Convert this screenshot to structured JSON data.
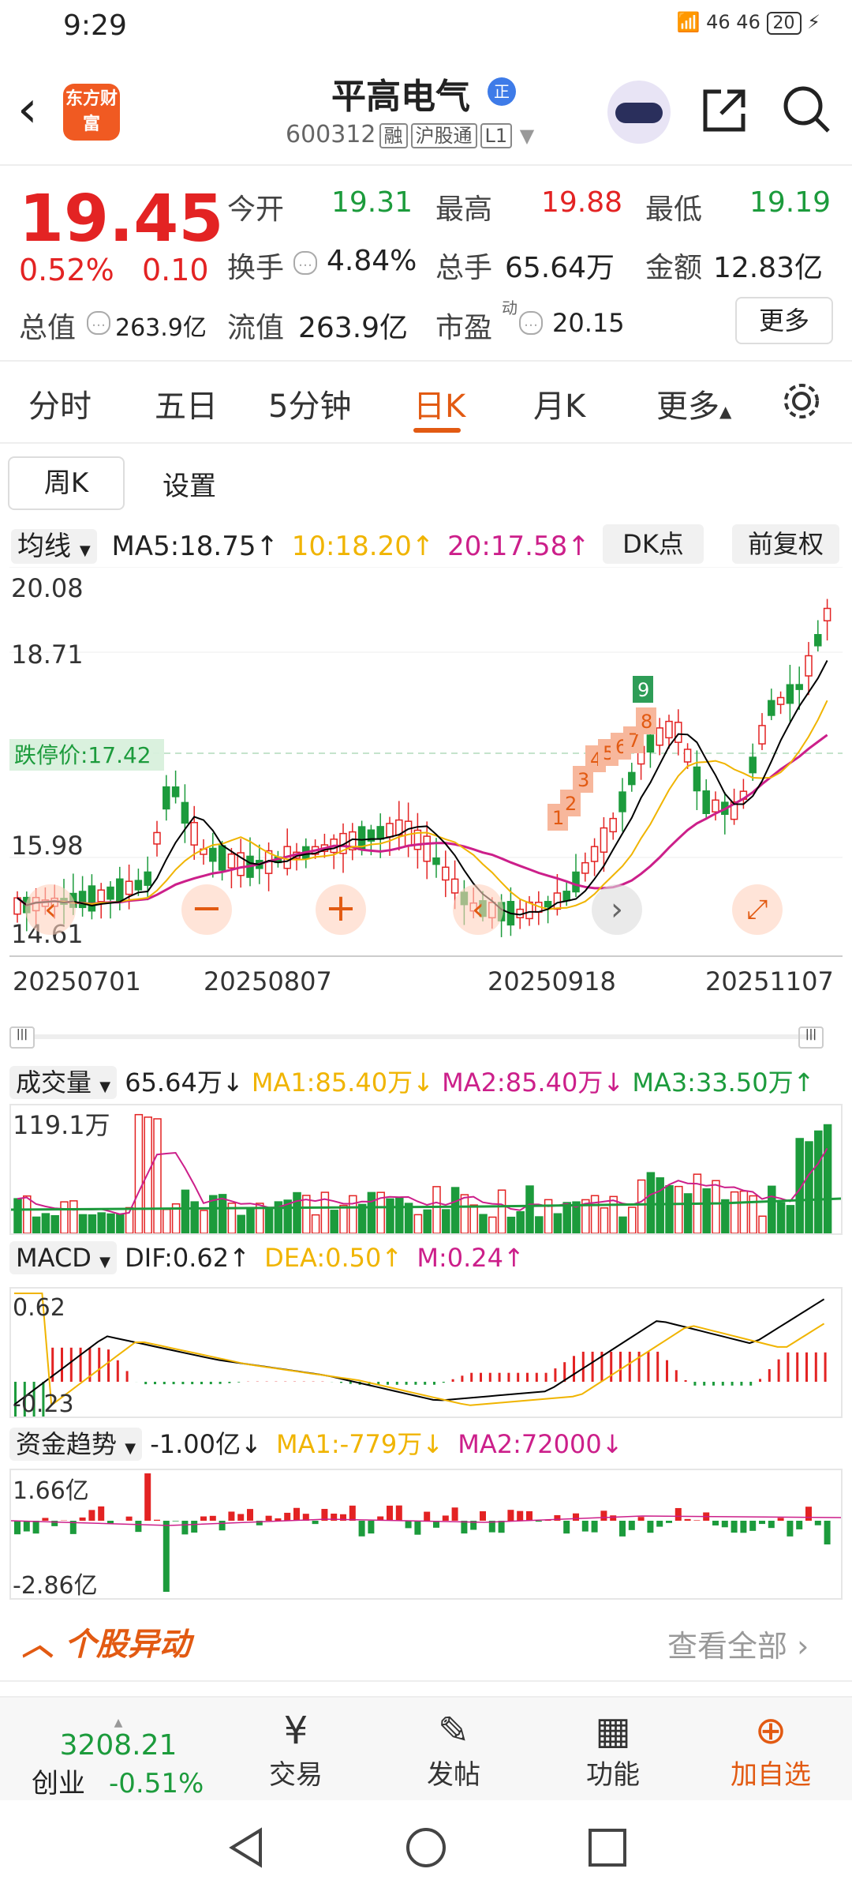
{
  "status": {
    "time": "9:29",
    "signal": "46 46",
    "battery": "20"
  },
  "header": {
    "app_logo": "东方财富",
    "stock_name": "平高电气",
    "badge": "正",
    "code": "600312",
    "tags": [
      "融",
      "沪股通",
      "L1"
    ]
  },
  "quote": {
    "price": "19.45",
    "pct": "0.52%",
    "change": "0.10",
    "open_label": "今开",
    "open": "19.31",
    "high_label": "最高",
    "high": "19.88",
    "low_label": "最低",
    "low": "19.19",
    "turnover_label": "换手",
    "turnover": "4.84%",
    "volume_label": "总手",
    "volume": "65.64万",
    "amount_label": "金额",
    "amount": "12.83亿",
    "mktcap_label": "总值",
    "mktcap": "263.9亿",
    "float_label": "流值",
    "float": "263.9亿",
    "pe_label": "市盈",
    "pe_sup": "动",
    "pe": "20.15",
    "more": "更多"
  },
  "tabs": [
    "分时",
    "五日",
    "5分钟",
    "日K",
    "月K",
    "更多"
  ],
  "sub": {
    "week": "周K",
    "settings": "设置"
  },
  "ma_legend": {
    "label": "均线",
    "ma5": "MA5:18.75↑",
    "ma10": "10:18.20↑",
    "ma20": "20:17.58↑",
    "dk": "DK点",
    "fq": "前复权"
  },
  "chart_data": {
    "type": "candlestick",
    "y_ticks": [
      "20.08",
      "18.71",
      "15.98",
      "14.61"
    ],
    "limit_down_label": "跌停价:17.42",
    "x_ticks": [
      "20250701",
      "20250807",
      "20250918",
      "20251107"
    ],
    "signals": [
      "1",
      "2",
      "3",
      "4",
      "5",
      "6",
      "7",
      "8",
      "9"
    ]
  },
  "volume": {
    "label": "成交量",
    "value": "65.64万↓",
    "ma1": "MA1:85.40万↓",
    "ma2": "MA2:85.40万↓",
    "ma3": "MA3:33.50万↑",
    "ymax": "119.1万"
  },
  "macd": {
    "label": "MACD",
    "dif": "DIF:0.62↑",
    "dea": "DEA:0.50↑",
    "m": "M:0.24↑",
    "ytop": "0.62",
    "ybot": "-0.23"
  },
  "fund": {
    "label": "资金趋势",
    "value": "-1.00亿↓",
    "ma1": "MA1:-779万↓",
    "ma2": "MA2:72000↓",
    "ytop": "1.66亿",
    "ybot": "-2.86亿"
  },
  "alert": {
    "title": "个股异动",
    "see_all": "查看全部"
  },
  "bottom_nav": {
    "index_value": "3208.21",
    "index_name": "创业",
    "index_pct": "-0.51%",
    "trade": "交易",
    "post": "发帖",
    "func": "功能",
    "add": "加自选"
  },
  "colors": {
    "up": "#e32323",
    "down": "#1c9b3c",
    "accent": "#e25a12",
    "ma5": "#000000",
    "ma10": "#f0b400",
    "ma20": "#cc1f8a"
  }
}
